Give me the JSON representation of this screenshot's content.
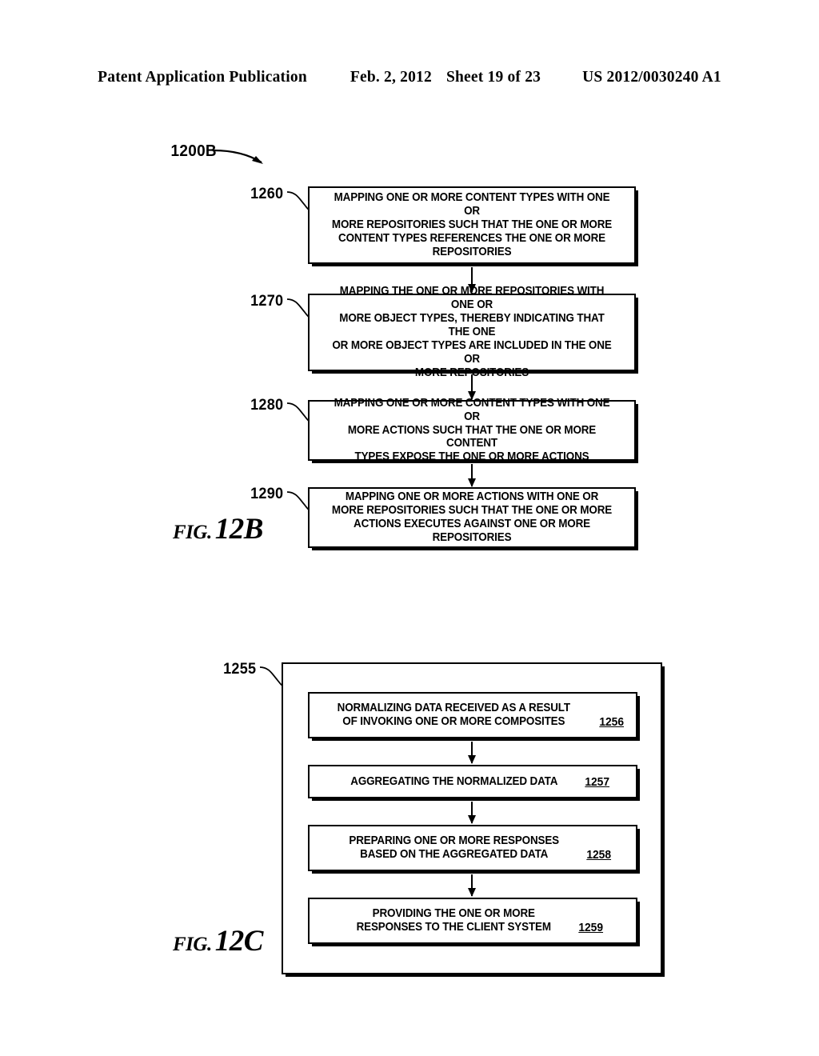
{
  "header": {
    "publication": "Patent Application Publication",
    "date": "Feb. 2, 2012",
    "sheet": "Sheet 19 of 23",
    "patent_number": "US 2012/0030240 A1"
  },
  "fig12b": {
    "caption_word": "FIG.",
    "caption_num": "12B",
    "diagram_ref": "1200B",
    "steps": [
      {
        "ref": "1260",
        "text": "MAPPING ONE OR MORE CONTENT TYPES WITH ONE OR\nMORE REPOSITORIES SUCH THAT THE ONE OR MORE\nCONTENT TYPES REFERENCES THE ONE OR MORE\nREPOSITORIES"
      },
      {
        "ref": "1270",
        "text": "MAPPING THE ONE OR MORE REPOSITORIES WITH ONE OR\nMORE OBJECT TYPES, THEREBY INDICATING THAT THE ONE\nOR MORE OBJECT TYPES ARE INCLUDED IN THE ONE OR\nMORE REPOSITORIES"
      },
      {
        "ref": "1280",
        "text": "MAPPING ONE OR MORE CONTENT TYPES WITH ONE OR\nMORE ACTIONS SUCH THAT THE ONE OR MORE CONTENT\nTYPES EXPOSE THE ONE OR MORE ACTIONS"
      },
      {
        "ref": "1290",
        "text": "MAPPING ONE OR MORE ACTIONS WITH ONE OR\nMORE REPOSITORIES SUCH THAT THE ONE OR MORE\nACTIONS EXECUTES AGAINST ONE OR MORE REPOSITORIES"
      }
    ]
  },
  "fig12c": {
    "caption_word": "FIG.",
    "caption_num": "12C",
    "container_ref": "1255",
    "steps": [
      {
        "ref": "1256",
        "text": "NORMALIZING DATA RECEIVED AS A RESULT\nOF INVOKING ONE OR MORE COMPOSITES"
      },
      {
        "ref": "1257",
        "text": "AGGREGATING THE NORMALIZED DATA"
      },
      {
        "ref": "1258",
        "text": "PREPARING ONE OR MORE RESPONSES\nBASED ON THE AGGREGATED DATA"
      },
      {
        "ref": "1259",
        "text": "PROVIDING THE ONE OR MORE\nRESPONSES TO THE CLIENT SYSTEM"
      }
    ]
  }
}
